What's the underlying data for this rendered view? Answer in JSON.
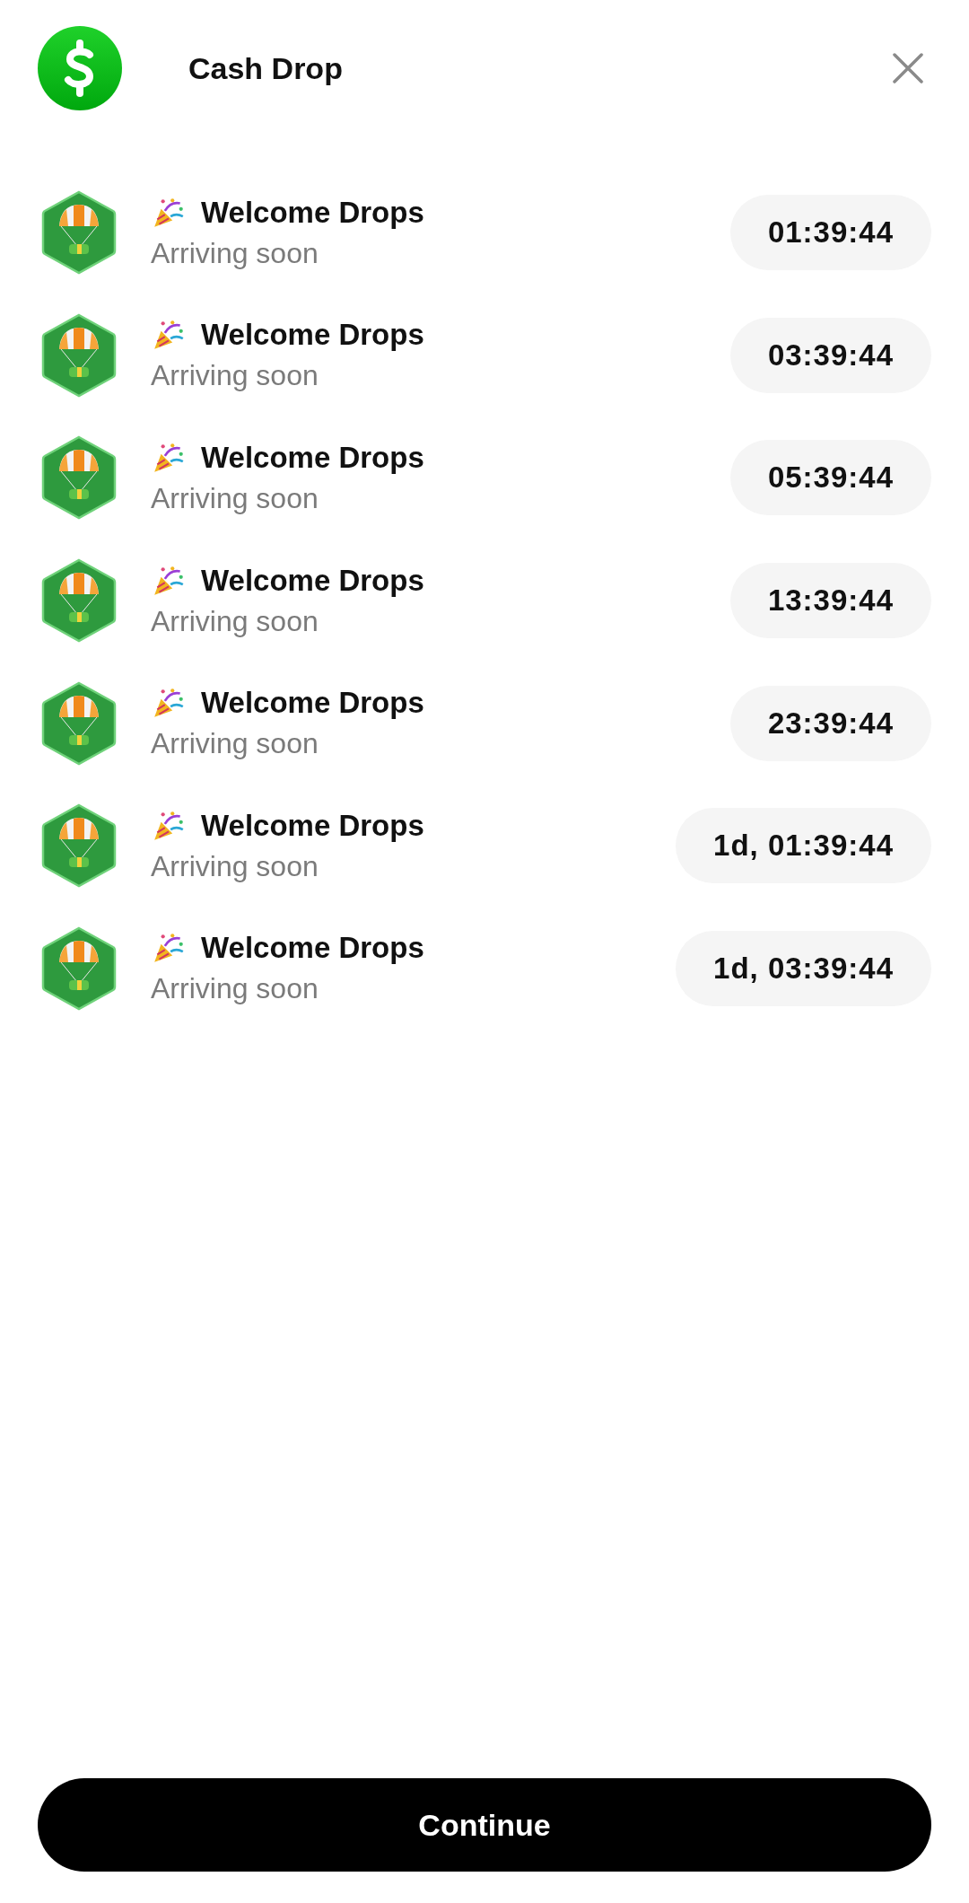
{
  "header": {
    "title": "Cash Drop"
  },
  "drops": [
    {
      "title": "Welcome Drops",
      "subtitle": "Arriving soon",
      "timer": "01:39:44"
    },
    {
      "title": "Welcome Drops",
      "subtitle": "Arriving soon",
      "timer": "03:39:44"
    },
    {
      "title": "Welcome Drops",
      "subtitle": "Arriving soon",
      "timer": "05:39:44"
    },
    {
      "title": "Welcome Drops",
      "subtitle": "Arriving soon",
      "timer": "13:39:44"
    },
    {
      "title": "Welcome Drops",
      "subtitle": "Arriving soon",
      "timer": "23:39:44"
    },
    {
      "title": "Welcome Drops",
      "subtitle": "Arriving soon",
      "timer": "1d, 01:39:44"
    },
    {
      "title": "Welcome Drops",
      "subtitle": "Arriving soon",
      "timer": "1d, 03:39:44"
    }
  ],
  "primary_button": {
    "label": "Continue"
  }
}
